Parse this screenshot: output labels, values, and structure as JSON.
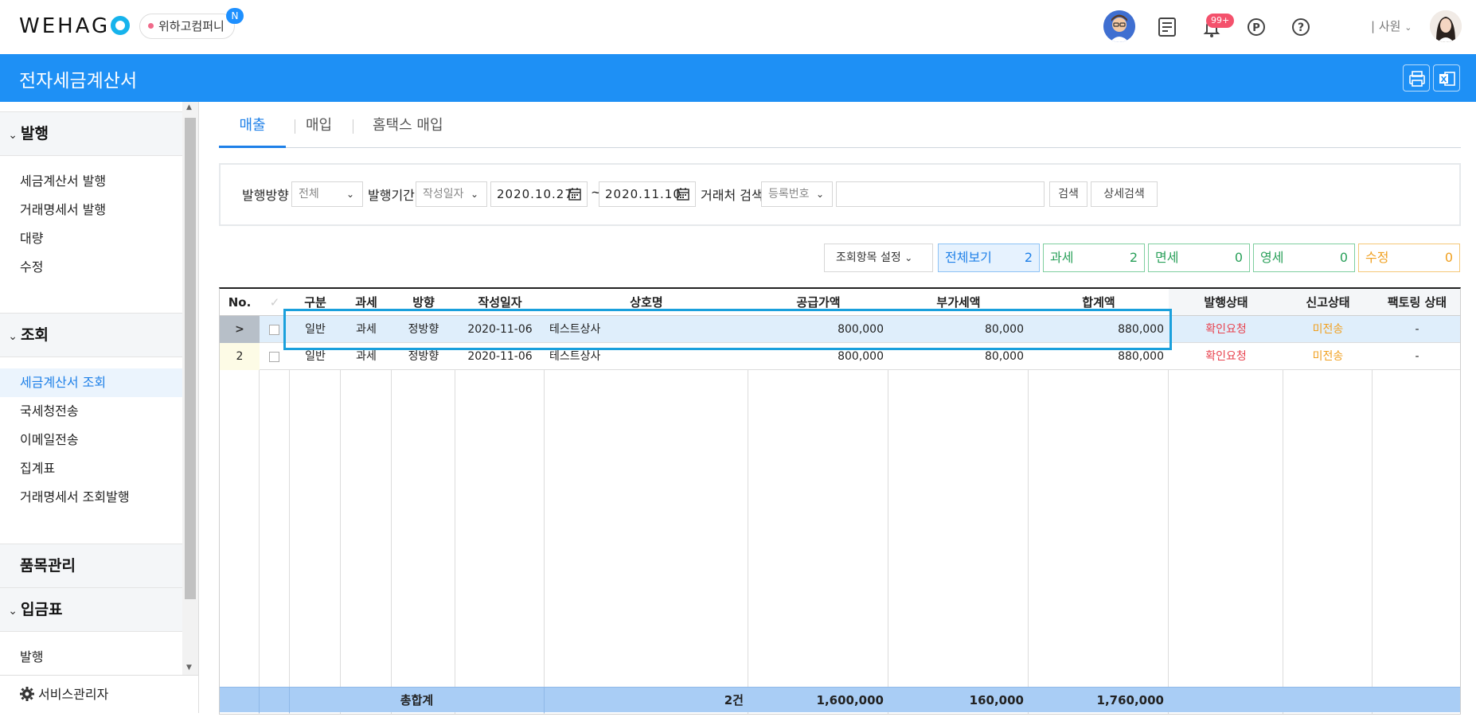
{
  "app": {
    "logo": "WEHAG",
    "company": "위하고컴퍼니",
    "company_badge": "N",
    "notification_count": "99+",
    "user_label": "| 사원"
  },
  "header": {
    "title": "전자세금계산서"
  },
  "sidebar": {
    "sections": [
      {
        "label": "발행",
        "chevron": "›"
      },
      {
        "label": "조회",
        "chevron": "›"
      },
      {
        "label": "품목관리",
        "chevron": ""
      },
      {
        "label": "입금표",
        "chevron": "›"
      }
    ],
    "issue_items": [
      "세금계산서 발행",
      "거래명세서 발행",
      "대량",
      "수정"
    ],
    "query_items": [
      "세금계산서 조회",
      "국세청전송",
      "이메일전송",
      "집계표",
      "거래명세서 조회발행"
    ],
    "deposit_items": [
      "발행"
    ],
    "footer": "서비스관리자"
  },
  "tabs": [
    "매출",
    "매입",
    "홈택스 매입"
  ],
  "filter": {
    "direction_label": "발행방향",
    "direction_value": "전체",
    "period_label": "발행기간",
    "period_type": "작성일자",
    "date_from": "2020.10.27",
    "date_sep": "~",
    "date_to": "2020.11.10",
    "partner_label": "거래처 검색",
    "partner_type": "등록번호",
    "partner_value": "",
    "search_btn": "검색",
    "detail_btn": "상세검색"
  },
  "summary": {
    "column_settings": "조회항목 설정",
    "chips": [
      {
        "label": "전체보기",
        "count": "2",
        "color": "#1e80e8"
      },
      {
        "label": "과세",
        "count": "2",
        "color": "#2aa05a"
      },
      {
        "label": "면세",
        "count": "0",
        "color": "#2aa05a"
      },
      {
        "label": "영세",
        "count": "0",
        "color": "#2aa05a"
      },
      {
        "label": "수정",
        "count": "0",
        "color": "#f0a020"
      }
    ]
  },
  "table": {
    "headers": [
      "No.",
      "✓",
      "구분",
      "과세",
      "방향",
      "작성일자",
      "상호명",
      "공급가액",
      "부가세액",
      "합계액",
      "발행상태",
      "신고상태",
      "팩토링 상태"
    ],
    "rows": [
      {
        "no": ">",
        "type": "일반",
        "tax": "과세",
        "dir": "정방향",
        "date": "2020-11-06",
        "name": "테스트상사",
        "supply": "800,000",
        "vat": "80,000",
        "total": "880,000",
        "issue": "확인요청",
        "report": "미전송",
        "factoring": "-"
      },
      {
        "no": "2",
        "type": "일반",
        "tax": "과세",
        "dir": "정방향",
        "date": "2020-11-06",
        "name": "테스트상사",
        "supply": "800,000",
        "vat": "80,000",
        "total": "880,000",
        "issue": "확인요청",
        "report": "미전송",
        "factoring": "-"
      }
    ],
    "total": {
      "label": "총합계",
      "count": "2건",
      "supply": "1,600,000",
      "vat": "160,000",
      "total": "1,760,000"
    }
  }
}
